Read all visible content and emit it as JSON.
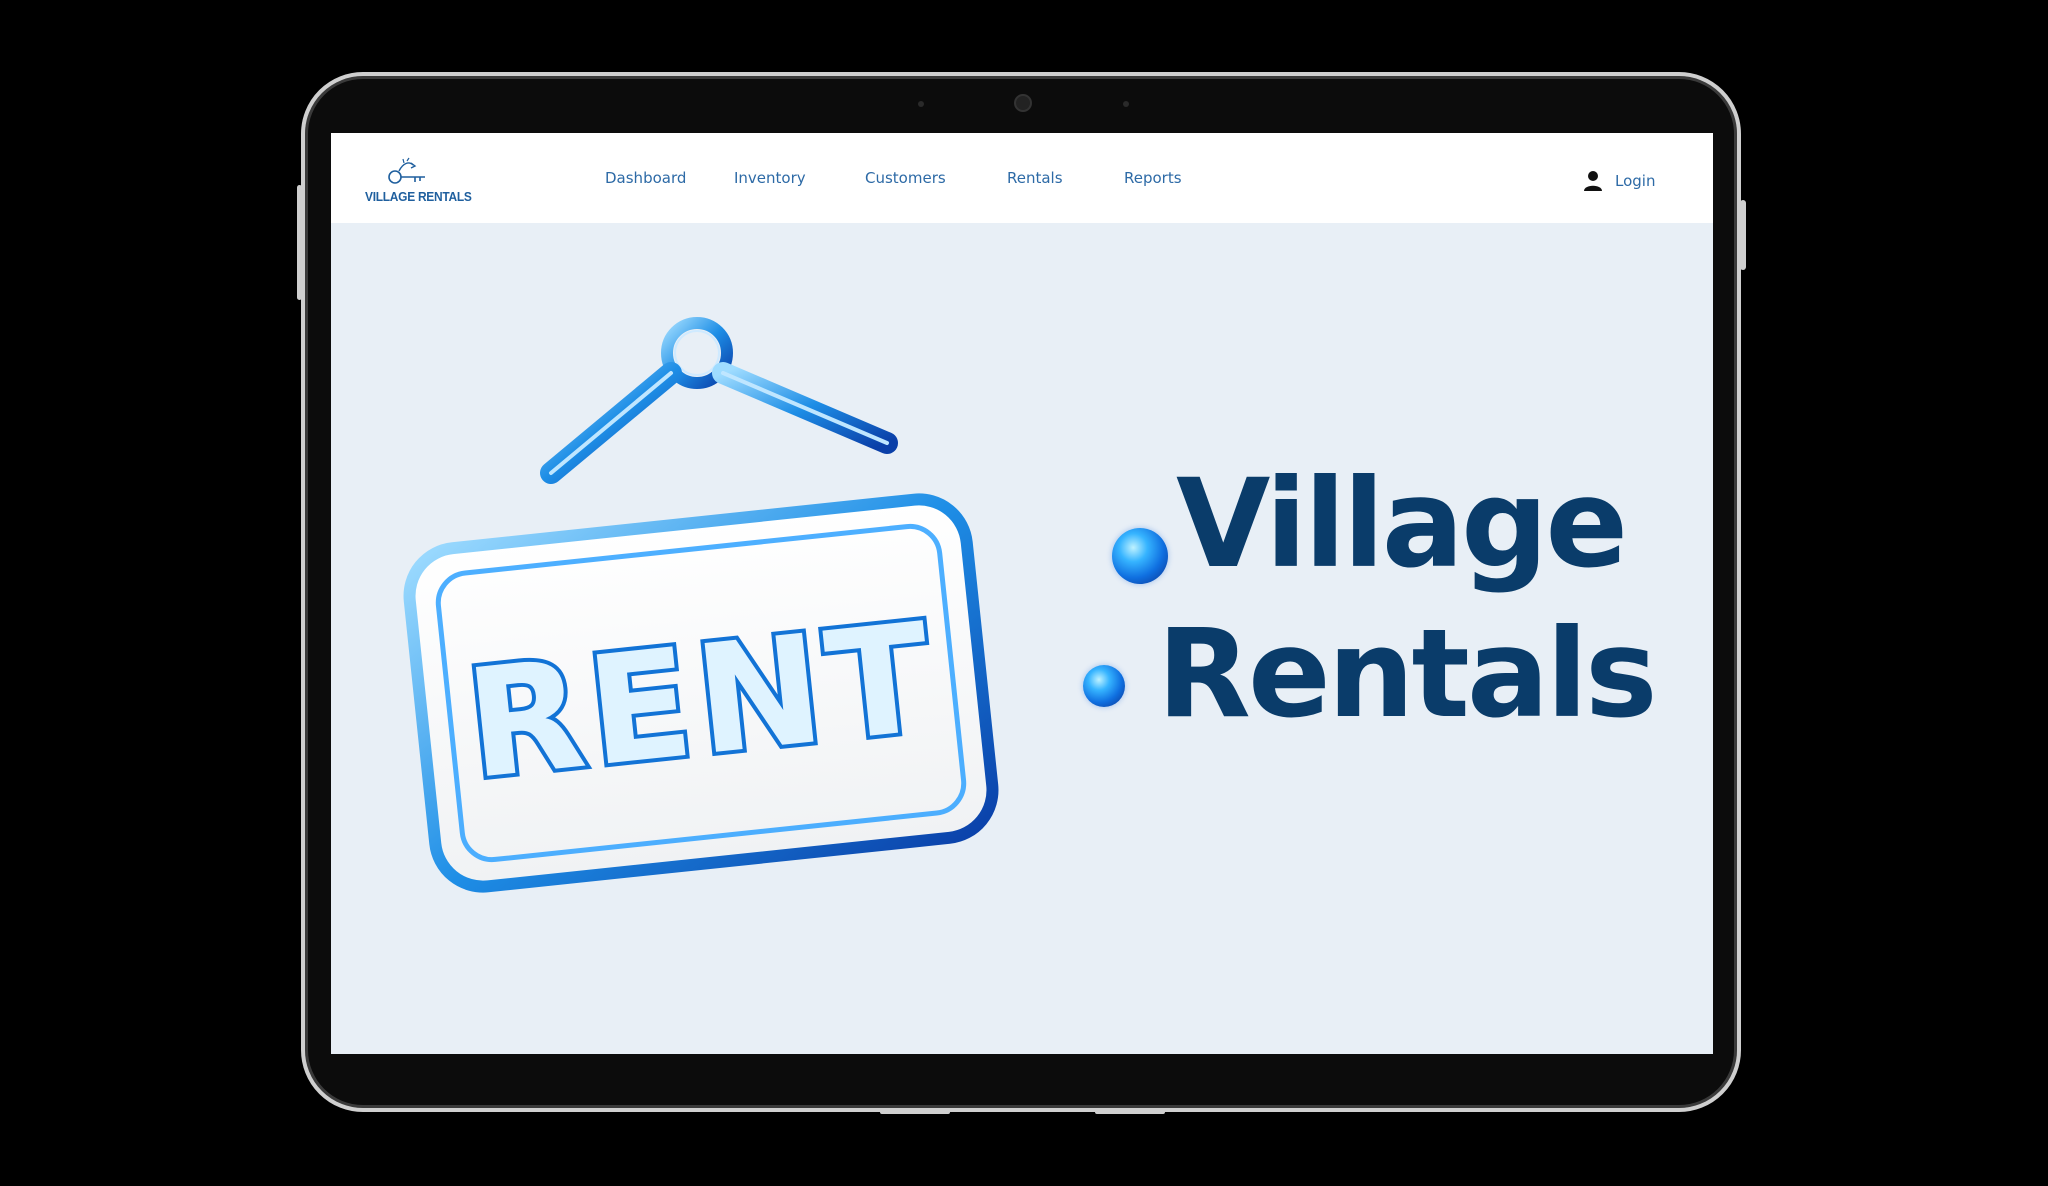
{
  "app": {
    "logo_text": "VILLAGE RENTALS"
  },
  "nav": {
    "items": [
      {
        "label": "Dashboard"
      },
      {
        "label": "Inventory"
      },
      {
        "label": "Customers"
      },
      {
        "label": "Rentals"
      },
      {
        "label": "Reports"
      }
    ],
    "login_label": "Login"
  },
  "hero": {
    "title_line1": "Village",
    "title_line2": "Rentals",
    "sign_text": "RENT"
  },
  "colors": {
    "accent": "#2d6aa6",
    "title": "#0a3c6a",
    "background": "#e8eff6",
    "sign_blue": "#1e8ee6"
  },
  "icons": {
    "login": "user-icon",
    "logo": "key-logo-icon"
  }
}
